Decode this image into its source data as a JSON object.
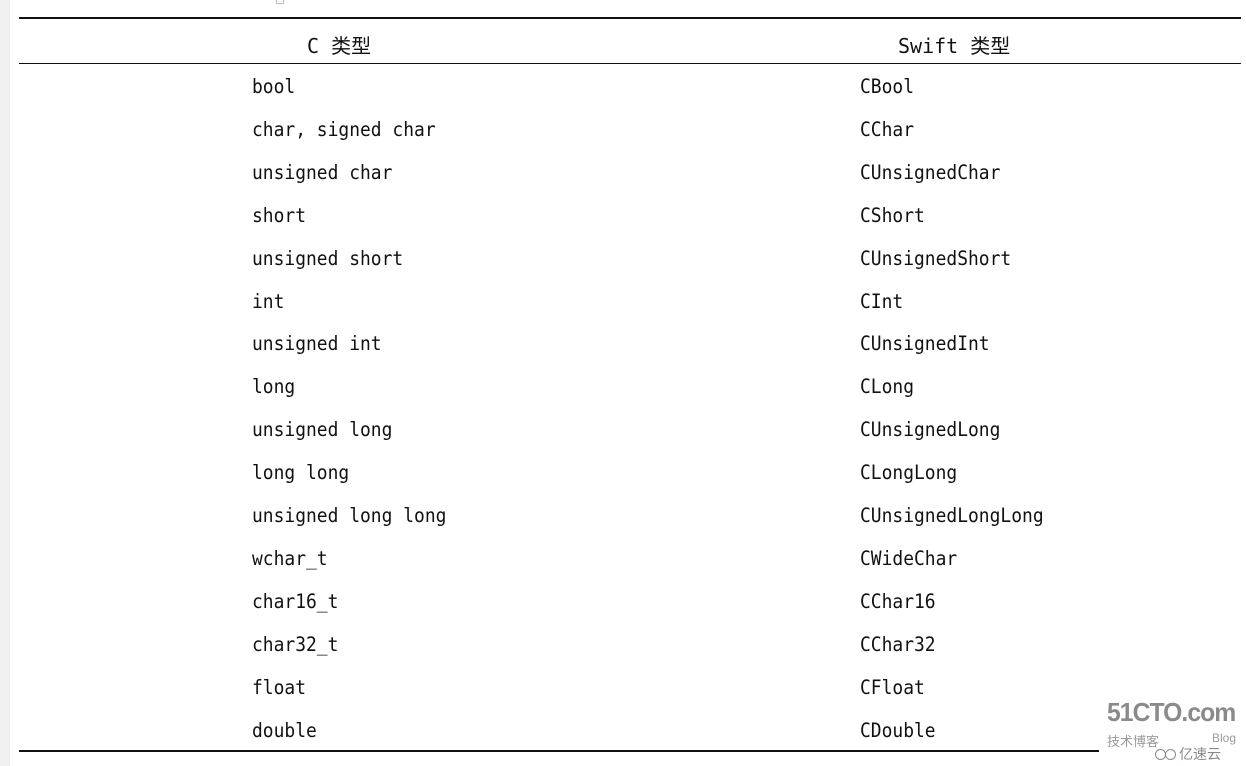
{
  "table": {
    "headers": [
      "C 类型",
      "Swift 类型"
    ],
    "rows": [
      [
        "bool",
        "CBool"
      ],
      [
        "char, signed char",
        "CChar"
      ],
      [
        "unsigned char",
        "CUnsignedChar"
      ],
      [
        "short",
        "CShort"
      ],
      [
        "unsigned short",
        "CUnsignedShort"
      ],
      [
        "int",
        "CInt"
      ],
      [
        "unsigned int",
        "CUnsignedInt"
      ],
      [
        "long",
        "CLong"
      ],
      [
        "unsigned long",
        "CUnsignedLong"
      ],
      [
        "long long",
        "CLongLong"
      ],
      [
        "unsigned long long",
        "CUnsignedLongLong"
      ],
      [
        "wchar_t",
        "CWideChar"
      ],
      [
        "char16_t",
        "CChar16"
      ],
      [
        "char32_t",
        "CChar32"
      ],
      [
        "float",
        "CFloat"
      ],
      [
        "double",
        "CDouble"
      ]
    ]
  },
  "watermark": {
    "brand": "51CTO.com",
    "subtitle": "技术博客",
    "blog": "Blog",
    "partner": "亿速云",
    "partner_icon": "yisu-cloud-logo-icon"
  }
}
